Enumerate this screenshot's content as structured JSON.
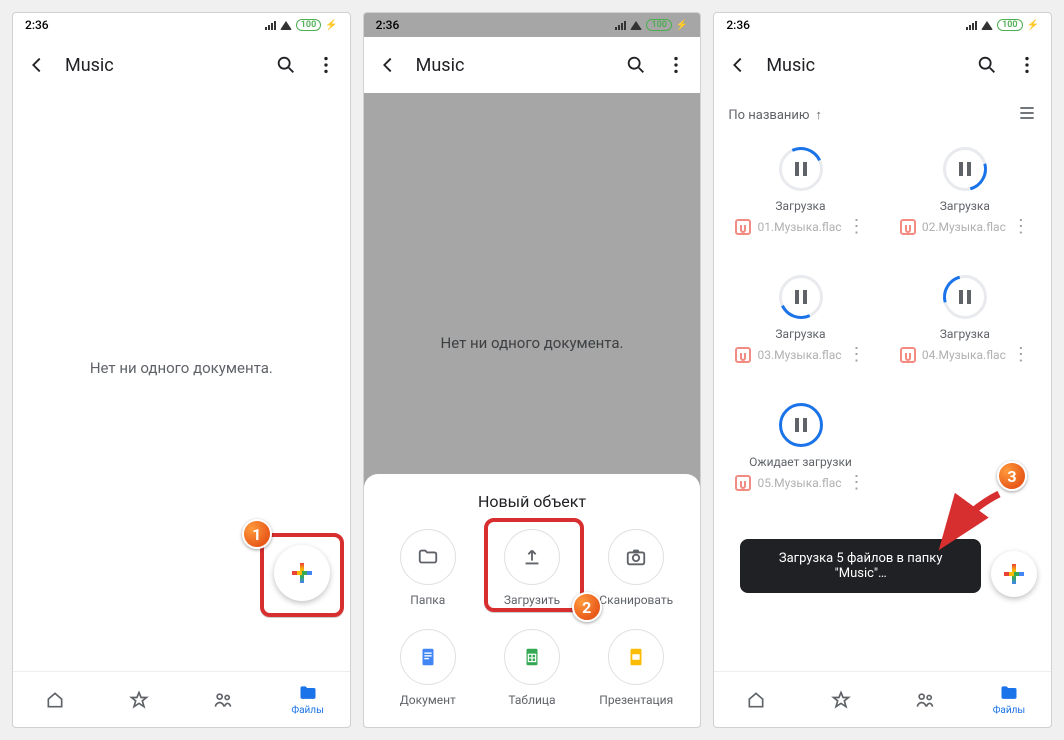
{
  "status": {
    "time": "2:36",
    "battery": "100"
  },
  "appbar": {
    "title": "Music"
  },
  "screen1": {
    "empty": "Нет ни одного документа."
  },
  "screen2": {
    "empty": "Нет ни одного документа.",
    "sheet_title": "Новый объект",
    "items": {
      "folder": "Папка",
      "upload": "Загрузить",
      "scan": "Сканировать",
      "doc": "Документ",
      "sheet": "Таблица",
      "slides": "Презентация"
    }
  },
  "screen3": {
    "sort_label": "По названию",
    "status_loading": "Загрузка",
    "status_waiting": "Ожидает загрузки",
    "files": [
      {
        "name": "01.Музыка.flac"
      },
      {
        "name": "02.Музыка.flac"
      },
      {
        "name": "03.Музыка.flac"
      },
      {
        "name": "04.Музыка.flac"
      },
      {
        "name": "05.Музыка.flac"
      }
    ],
    "toast": "Загрузка 5 файлов в папку \"Music\"…"
  },
  "bottomnav": {
    "home": "",
    "starred": "",
    "shared": "",
    "files": "Файлы"
  },
  "callouts": {
    "1": "1",
    "2": "2",
    "3": "3"
  }
}
